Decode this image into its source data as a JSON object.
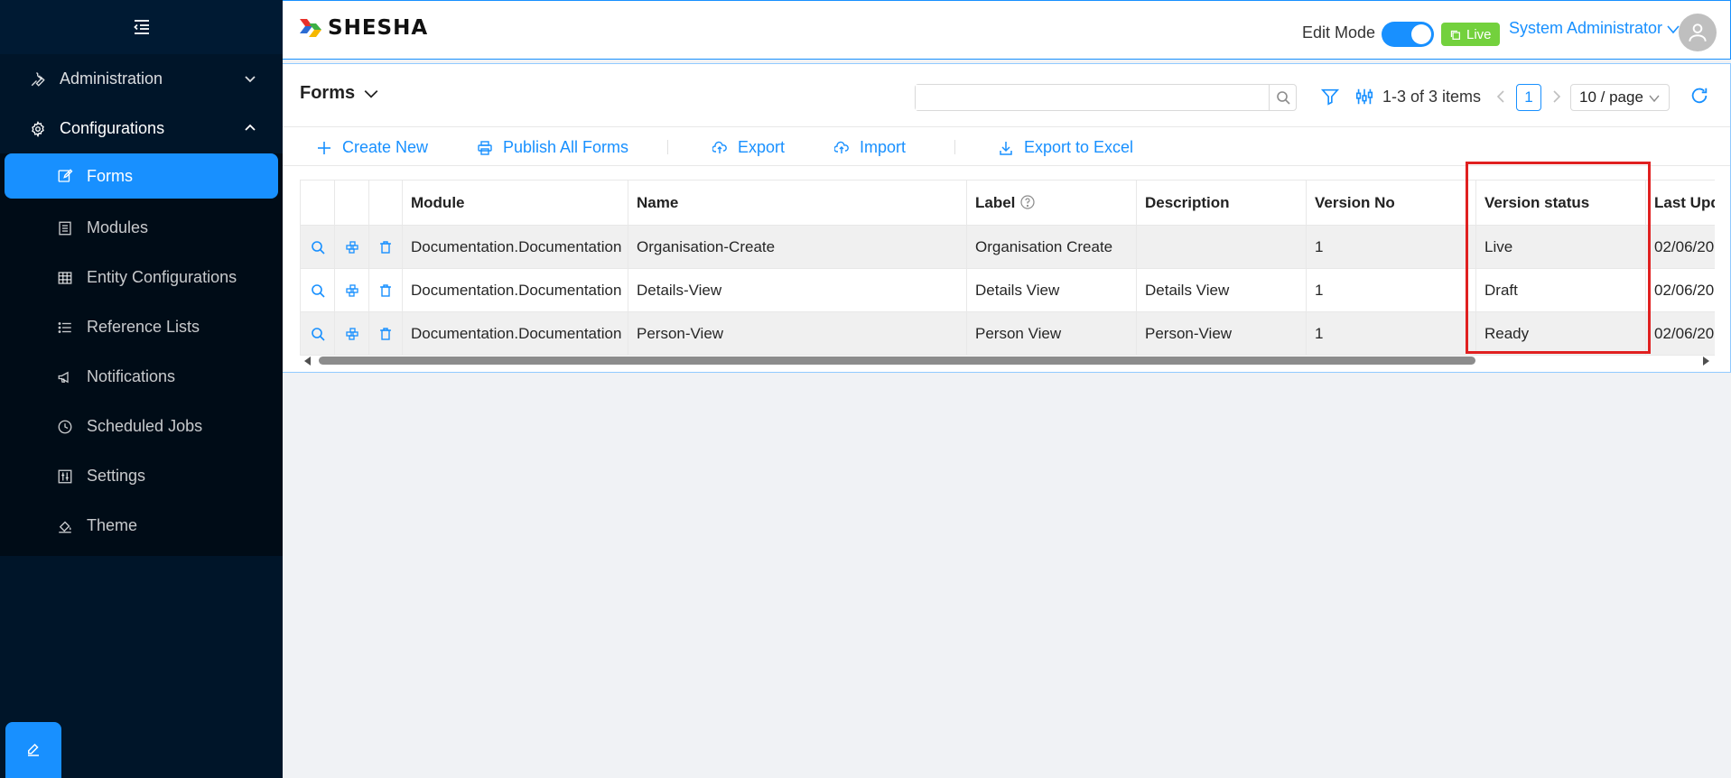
{
  "sidebar": {
    "items": [
      {
        "label": "Administration",
        "icon": "wrench-icon",
        "expanded": false
      },
      {
        "label": "Configurations",
        "icon": "gear-icon",
        "expanded": true
      }
    ],
    "sub_items": [
      {
        "label": "Forms",
        "icon": "form-edit-icon",
        "active": true
      },
      {
        "label": "Modules",
        "icon": "module-icon"
      },
      {
        "label": "Entity Configurations",
        "icon": "table-grid-icon"
      },
      {
        "label": "Reference Lists",
        "icon": "list-icon"
      },
      {
        "label": "Notifications",
        "icon": "megaphone-icon"
      },
      {
        "label": "Scheduled Jobs",
        "icon": "clock-icon"
      },
      {
        "label": "Settings",
        "icon": "sliders-icon"
      },
      {
        "label": "Theme",
        "icon": "paint-bucket-icon"
      }
    ]
  },
  "header": {
    "logo_text": "SHESHA",
    "edit_mode_label": "Edit Mode",
    "edit_mode_on": true,
    "live_badge": "Live",
    "user_name": "System Administrator"
  },
  "page": {
    "title": "Forms",
    "search": {
      "value": "",
      "placeholder": ""
    },
    "count_text": "1-3 of 3 items",
    "current_page": "1",
    "page_size": "10 / page"
  },
  "toolbar": {
    "create_new": "Create New",
    "publish_all": "Publish All Forms",
    "export": "Export",
    "import": "Import",
    "export_excel": "Export to Excel"
  },
  "table": {
    "columns": {
      "module": "Module",
      "name": "Name",
      "label": "Label",
      "description": "Description",
      "version_no": "Version No",
      "version_status": "Version status",
      "last_updated": "Last Upd"
    },
    "rows": [
      {
        "module": "Documentation.Documentation",
        "name": "Organisation-Create",
        "label": "Organisation Create",
        "description": "",
        "version_no": "1",
        "version_status": "Live",
        "last_updated": "02/06/20"
      },
      {
        "module": "Documentation.Documentation",
        "name": "Details-View",
        "label": "Details View",
        "description": "Details View",
        "version_no": "1",
        "version_status": "Draft",
        "last_updated": "02/06/20"
      },
      {
        "module": "Documentation.Documentation",
        "name": "Person-View",
        "label": "Person View",
        "description": "Person-View",
        "version_no": "1",
        "version_status": "Ready",
        "last_updated": "02/06/20"
      }
    ]
  },
  "colors": {
    "accent": "#1890ff",
    "sidebar_bg": "#001529",
    "live_badge": "#73d13d",
    "highlight": "#e02020"
  }
}
